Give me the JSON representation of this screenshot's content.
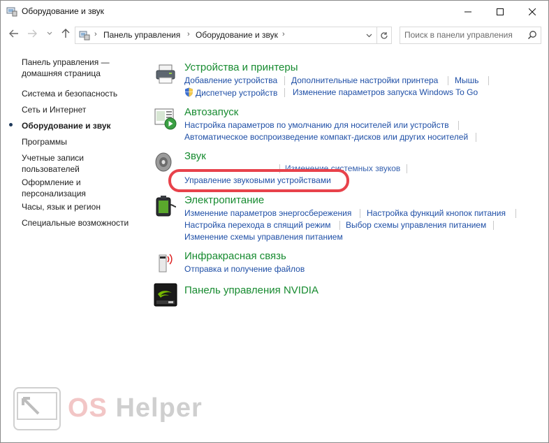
{
  "window": {
    "title": "Оборудование и звук"
  },
  "address": {
    "crumbs": [
      "Панель управления",
      "Оборудование и звук"
    ]
  },
  "search": {
    "placeholder": "Поиск в панели управления"
  },
  "leftnav": {
    "items": [
      {
        "label": "Панель управления —\nдомашняя страница",
        "active": false
      },
      {
        "label": "Система и безопасность",
        "active": false
      },
      {
        "label": "Сеть и Интернет",
        "active": false
      },
      {
        "label": "Оборудование и звук",
        "active": true
      },
      {
        "label": "Программы",
        "active": false
      },
      {
        "label": "Учетные записи\nпользователей",
        "active": false
      },
      {
        "label": "Оформление и\nперсонализация",
        "active": false
      },
      {
        "label": "Часы, язык и регион",
        "active": false
      },
      {
        "label": "Специальные возможности",
        "active": false
      }
    ]
  },
  "categories": [
    {
      "title": "Устройства и принтеры",
      "icon": "printer-icon",
      "links": [
        "Добавление устройства",
        "Дополнительные настройки принтера",
        "Мышь",
        "Диспетчер устройств",
        "Изменение параметров запуска Windows To Go"
      ]
    },
    {
      "title": "Автозапуск",
      "icon": "autoplay-icon",
      "links": [
        "Настройка параметров по умолчанию для носителей или устройств",
        "Автоматическое воспроизведение компакт-дисков или других носителей"
      ]
    },
    {
      "title": "Звук",
      "icon": "speaker-icon",
      "links": [
        "Изменение системных звуков",
        "Управление звуковыми устройствами"
      ]
    },
    {
      "title": "Электропитание",
      "icon": "battery-icon",
      "links": [
        "Изменение параметров энергосбережения",
        "Настройка функций кнопок питания",
        "Настройка перехода в спящий режим",
        "Выбор схемы управления питанием",
        "Изменение схемы управления питанием"
      ]
    },
    {
      "title": "Инфракрасная связь",
      "icon": "infrared-icon",
      "links": [
        "Отправка и получение файлов"
      ]
    },
    {
      "title": "Панель управления NVIDIA",
      "icon": "nvidia-icon",
      "links": []
    }
  ],
  "watermark": {
    "text_os": "OS",
    "text_helper": "Helper"
  },
  "colors": {
    "category_title": "#178b30",
    "link": "#1f4fa6",
    "highlight": "#e8424b"
  }
}
